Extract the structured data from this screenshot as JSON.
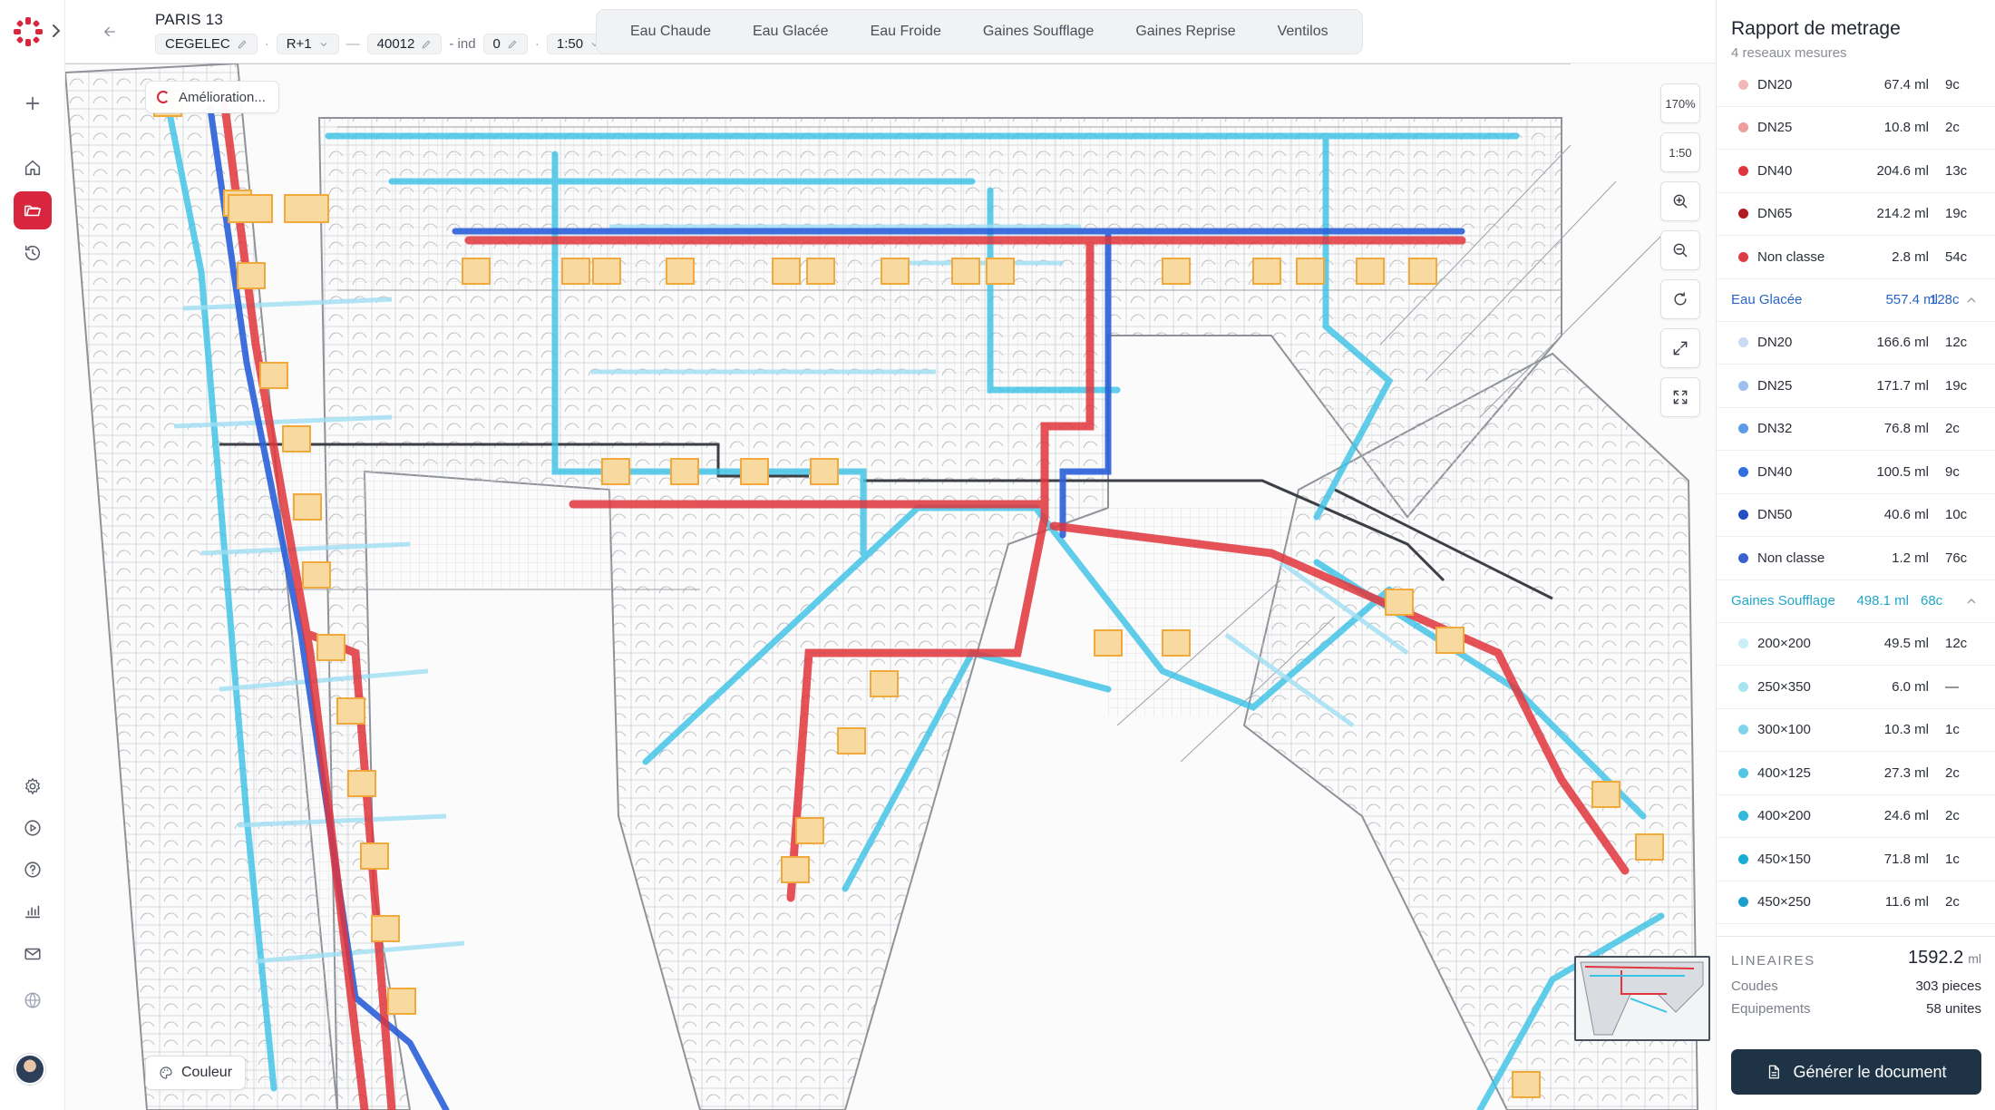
{
  "header": {
    "project_title": "PARIS 13",
    "company": "CEGELEC",
    "level": "R+1",
    "dash": "—",
    "code": "40012",
    "ind_label": "- ind",
    "ind_value": "0",
    "dot": "·",
    "scale": "1:50"
  },
  "tabs": [
    "Eau Chaude",
    "Eau Glacée",
    "Eau Froide",
    "Gaines Soufflage",
    "Gaines Reprise",
    "Ventilos"
  ],
  "map": {
    "status_chip": "Amélioration...",
    "color_button": "Couleur",
    "zoom_level": "170%",
    "scale_chip": "1:50"
  },
  "panel": {
    "title": "Rapport de metrage",
    "subtitle": "4 reseaux mesures",
    "rows_top": [
      {
        "label": "DN20",
        "ml": "67.4 ml",
        "count": "9c",
        "color": "#f2b8b8"
      },
      {
        "label": "DN25",
        "ml": "10.8 ml",
        "count": "2c",
        "color": "#ee9c9c"
      },
      {
        "label": "DN40",
        "ml": "204.6 ml",
        "count": "13c",
        "color": "#e0353c"
      },
      {
        "label": "DN65",
        "ml": "214.2 ml",
        "count": "19c",
        "color": "#b01b22"
      },
      {
        "label": "Non classe",
        "ml": "2.8 ml",
        "count": "54c",
        "color": "#dd3b45"
      }
    ],
    "group_glacee": {
      "label": "Eau Glacée",
      "ml": "557.4 ml",
      "count": "128c"
    },
    "rows_glacee": [
      {
        "label": "DN20",
        "ml": "166.6 ml",
        "count": "12c",
        "color": "#c9dbf4"
      },
      {
        "label": "DN25",
        "ml": "171.7 ml",
        "count": "19c",
        "color": "#9dbfee"
      },
      {
        "label": "DN32",
        "ml": "76.8 ml",
        "count": "2c",
        "color": "#5e9be6"
      },
      {
        "label": "DN40",
        "ml": "100.5 ml",
        "count": "9c",
        "color": "#2f6fe0"
      },
      {
        "label": "DN50",
        "ml": "40.6 ml",
        "count": "10c",
        "color": "#2250c4"
      },
      {
        "label": "Non classe",
        "ml": "1.2 ml",
        "count": "76c",
        "color": "#3a62cf"
      }
    ],
    "group_soufflage": {
      "label": "Gaines Soufflage",
      "ml": "498.1 ml",
      "count": "68c"
    },
    "rows_soufflage": [
      {
        "label": "200×200",
        "ml": "49.5 ml",
        "count": "12c",
        "color": "#c8eef7"
      },
      {
        "label": "250×350",
        "ml": "6.0 ml",
        "count": "—",
        "color": "#a8e3f2"
      },
      {
        "label": "300×100",
        "ml": "10.3 ml",
        "count": "1c",
        "color": "#7fd5ec"
      },
      {
        "label": "400×125",
        "ml": "27.3 ml",
        "count": "2c",
        "color": "#52c6e6"
      },
      {
        "label": "400×200",
        "ml": "24.6 ml",
        "count": "2c",
        "color": "#31b9de"
      },
      {
        "label": "450×150",
        "ml": "71.8 ml",
        "count": "1c",
        "color": "#19acd6"
      },
      {
        "label": "450×250",
        "ml": "11.6 ml",
        "count": "2c",
        "color": "#1aa0cc"
      }
    ],
    "totals": {
      "label": "LINEAIRES",
      "value": "1592.2",
      "unit": "ml",
      "coudes_label": "Coudes",
      "coudes_value": "303 pieces",
      "equip_label": "Equipements",
      "equip_value": "58 unites"
    },
    "generate_button": "Générer le document"
  }
}
